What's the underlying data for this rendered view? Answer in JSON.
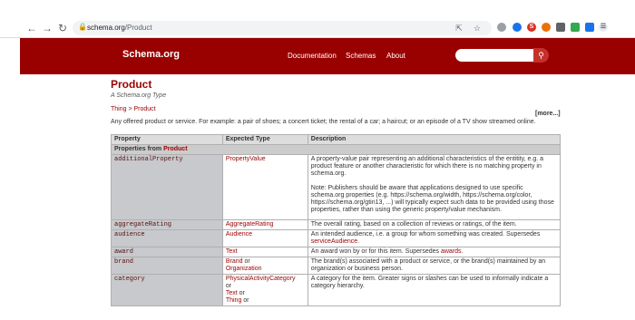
{
  "browser": {
    "back_icon": "arrow-left-icon",
    "forward_icon": "arrow-right-icon",
    "reload_icon": "reload-icon",
    "url_host": "schema.org",
    "url_path": "/Product"
  },
  "site": {
    "logo": "Schema.org",
    "nav": [
      "Documentation",
      "Schemas",
      "About"
    ],
    "search_placeholder": ""
  },
  "page": {
    "title": "Product",
    "subtitle": "A Schema.org Type",
    "breadcrumb": [
      "Thing",
      "Product"
    ],
    "breadcrumb_sep": " > ",
    "more": "[more...]",
    "description": "Any offered product or service. For example: a pair of shoes; a concert ticket; the rental of a car; a haircut; or an episode of a TV show streamed online."
  },
  "table": {
    "headers": [
      "Property",
      "Expected Type",
      "Description"
    ],
    "section_prefix": "Properties from ",
    "section_link": "Product",
    "rows": [
      {
        "property": "additionalProperty",
        "types": [
          "PropertyValue"
        ],
        "desc1": "A property-value pair representing an additional characteristics of the entitity, e.g. a product feature or another characteristic for which there is no matching property in schema.org.",
        "desc2": "Note: Publishers should be aware that applications designed to use specific schema.org properties (e.g. https://schema.org/width, https://schema.org/color, https://schema.org/gtin13, ...) will typically expect such data to be provided using those properties, rather than using the generic property/value mechanism."
      },
      {
        "property": "aggregateRating",
        "types": [
          "AggregateRating"
        ],
        "desc1": "The overall rating, based on a collection of reviews or ratings, of the item."
      },
      {
        "property": "audience",
        "types": [
          "Audience"
        ],
        "desc1": "An intended audience, i.e. a group for whom something was created. Supersedes ",
        "desc_link": "serviceAudience",
        "desc_end": "."
      },
      {
        "property": "award",
        "types": [
          "Text"
        ],
        "desc1": "An award won by or for this item. Supersedes ",
        "desc_link": "awards",
        "desc_end": "."
      },
      {
        "property": "brand",
        "types": [
          "Brand",
          "Organization"
        ],
        "desc1": "The brand(s) associated with a product or service, or the brand(s) maintained by an organization or business person."
      },
      {
        "property": "category",
        "types": [
          "PhysicalActivityCategory",
          "Text",
          "Thing"
        ],
        "desc1": "A category for the item. Greater signs or slashes can be used to informally indicate a category hierarchy."
      }
    ],
    "or_word": " or"
  },
  "colors": {
    "brand": "#990000",
    "property_cell": "#c7c9cc"
  }
}
